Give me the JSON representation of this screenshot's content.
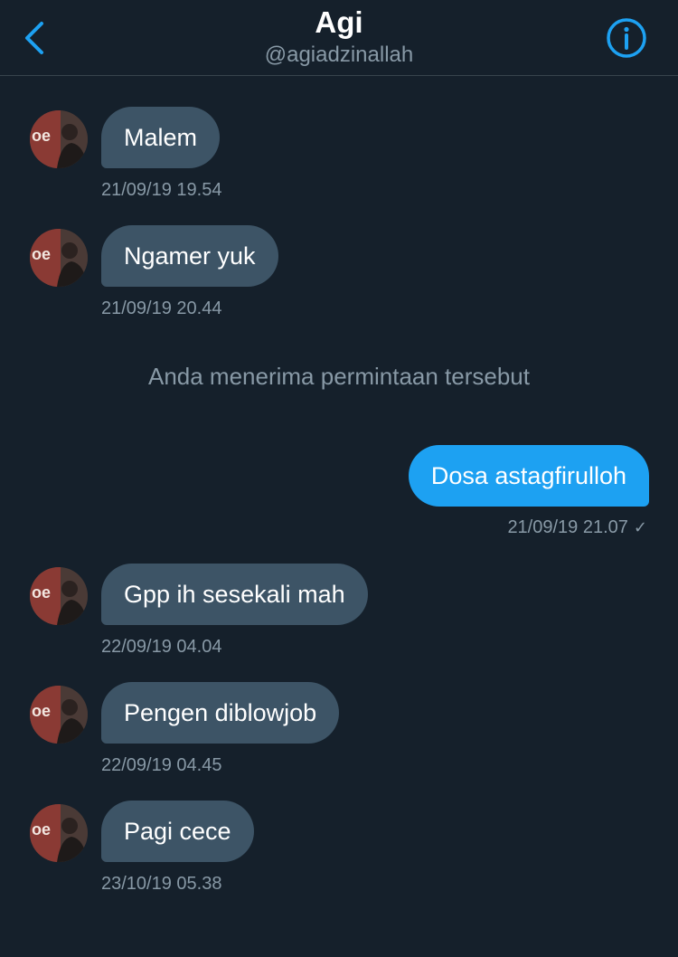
{
  "header": {
    "title": "Agi",
    "handle": "@agiadzinallah",
    "back_icon": "chevron-left-icon",
    "info_icon": "info-icon",
    "accent_color": "#1da1f2"
  },
  "system_note": "Anda menerima permintaan tersebut",
  "messages": [
    {
      "direction": "incoming",
      "text": "Malem",
      "time": "21/09/19 19.54"
    },
    {
      "direction": "incoming",
      "text": "Ngamer yuk",
      "time": "21/09/19 20.44"
    },
    {
      "direction": "outgoing",
      "text": "Dosa astagfirulloh",
      "time": "21/09/19 21.07",
      "status_icon": "checkmark-icon"
    },
    {
      "direction": "incoming",
      "text": "Gpp ih sesekali mah",
      "time": "22/09/19 04.04"
    },
    {
      "direction": "incoming",
      "text": "Pengen diblowjob",
      "time": "22/09/19 04.45"
    },
    {
      "direction": "incoming",
      "text": "Pagi cece",
      "time": "23/10/19 05.38"
    }
  ],
  "colors": {
    "background": "#15202b",
    "incoming_bubble": "#3d5466",
    "outgoing_bubble": "#1da1f2",
    "secondary_text": "#8899a6"
  }
}
